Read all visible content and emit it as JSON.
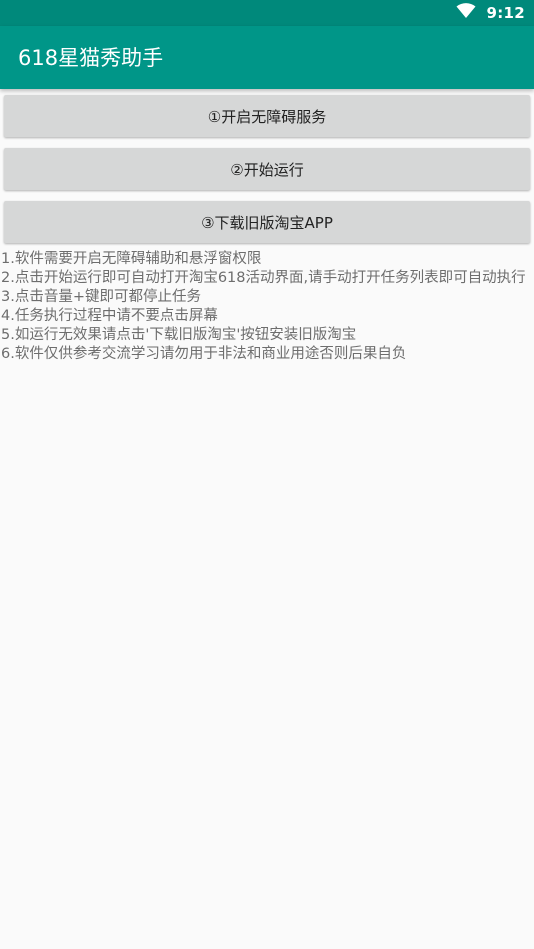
{
  "status_bar": {
    "time": "9:12",
    "wifi_icon": "wifi-icon"
  },
  "app_bar": {
    "title": "618星猫秀助手"
  },
  "buttons": [
    {
      "label": "①开启无障碍服务"
    },
    {
      "label": "②开始运行"
    },
    {
      "label": "③下载旧版淘宝APP"
    }
  ],
  "instructions": [
    "1.软件需要开启无障碍辅助和悬浮窗权限",
    "2.点击开始运行即可自动打开淘宝618活动界面,请手动打开任务列表即可自动执行",
    "3.点击音量+键即可都停止任务",
    "4.任务执行过程中请不要点击屏幕",
    "5.如运行无效果请点击'下载旧版淘宝'按钮安装旧版淘宝",
    "6.软件仅供参考交流学习请勿用于非法和商业用途否则后果自负"
  ],
  "colors": {
    "status_bar": "#00897b",
    "app_bar": "#009688",
    "button_bg": "#d6d7d7",
    "background": "#fafafa",
    "instruction_text": "#6d6d6d"
  }
}
